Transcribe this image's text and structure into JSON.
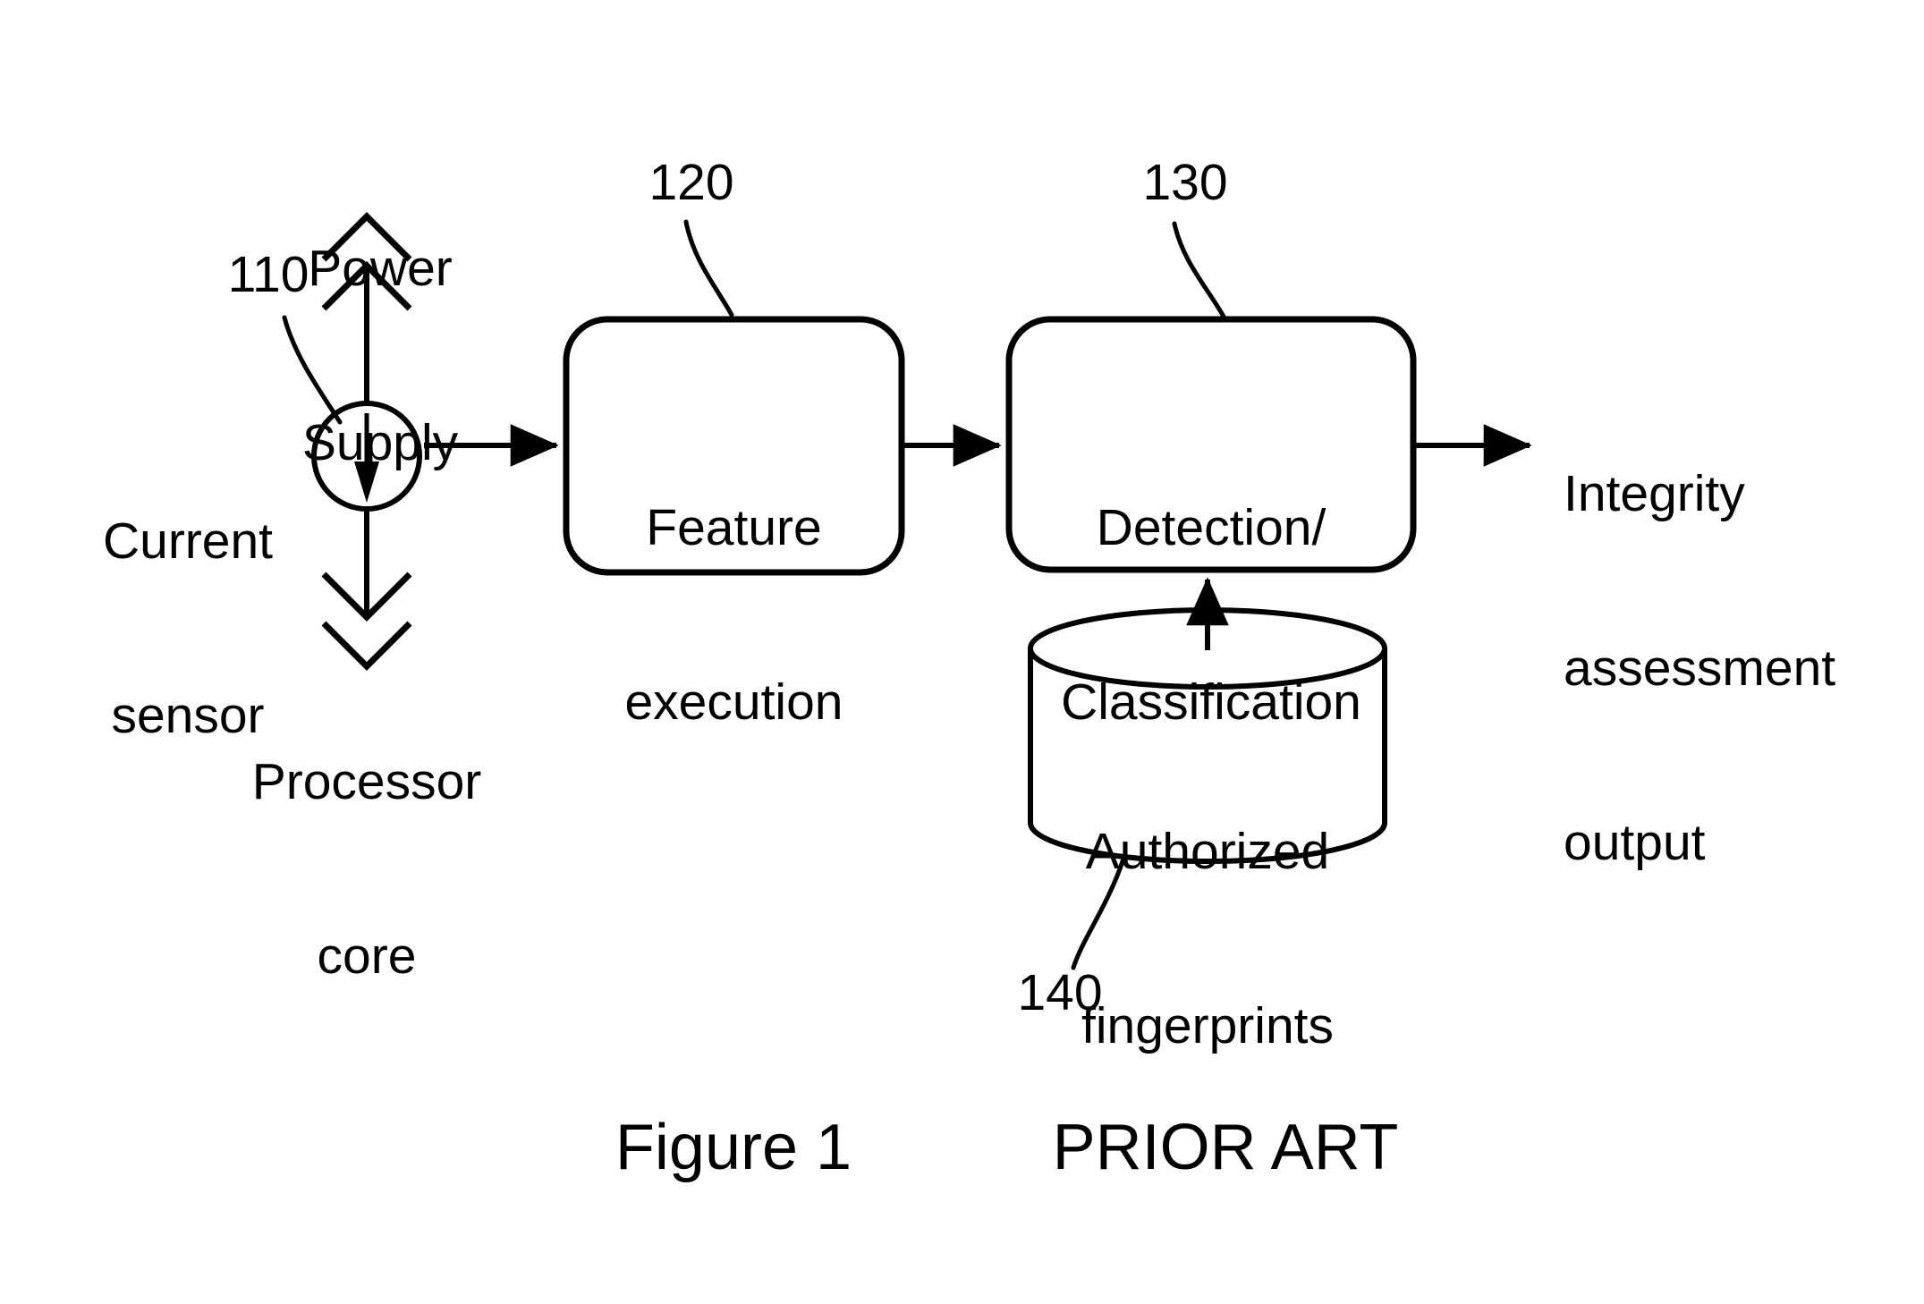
{
  "figure": {
    "caption_label": "Figure 1",
    "caption_note": "PRIOR ART"
  },
  "nodes": {
    "power_supply": {
      "label": "Power\nSupply",
      "line1": "Power",
      "line2": "Supply"
    },
    "current_sensor": {
      "label": "Current\nsensor",
      "line1": "Current",
      "line2": "sensor",
      "ref": "110"
    },
    "processor_core": {
      "label": "Processor\ncore",
      "line1": "Processor",
      "line2": "core"
    },
    "feature_execution": {
      "line1": "Feature",
      "line2": "execution",
      "ref": "120"
    },
    "detection_classification": {
      "line1": "Detection/",
      "line2": "Classification",
      "ref": "130"
    },
    "authorized_fingerprints": {
      "line1": "Authorized",
      "line2": "fingerprints",
      "ref": "140"
    },
    "output": {
      "line1": "Integrity",
      "line2": "assessment",
      "line3": "output"
    }
  },
  "style": {
    "stroke_color": "#000000",
    "background_color": "#ffffff",
    "text_color": "#000000"
  }
}
